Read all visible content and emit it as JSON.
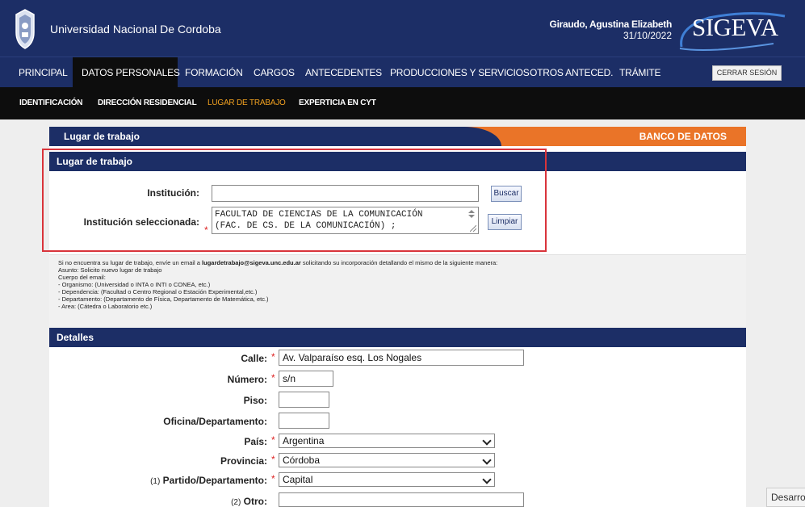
{
  "header": {
    "university": "Universidad Nacional De Cordoba",
    "user_name": "Giraudo, Agustina Elizabeth",
    "date": "31/10/2022",
    "logo": "SIGEVA"
  },
  "main_nav": [
    {
      "label": "PRINCIPAL",
      "active": false
    },
    {
      "label": "DATOS PERSONALES",
      "active": true
    },
    {
      "label": "FORMACIÓN",
      "active": false
    },
    {
      "label": "CARGOS",
      "active": false
    },
    {
      "label": "ANTECEDENTES",
      "active": false
    },
    {
      "label": "PRODUCCIONES Y SERVICIOS",
      "active": false
    },
    {
      "label": "OTROS ANTECED.",
      "active": false
    },
    {
      "label": "TRÁMITE",
      "active": false
    }
  ],
  "logout_label": "CERRAR SESIÓN",
  "sub_nav": [
    {
      "label": "IDENTIFICACIÓN",
      "active": false
    },
    {
      "label": "DIRECCIÓN RESIDENCIAL",
      "active": false
    },
    {
      "label": "LUGAR DE TRABAJO",
      "active": true
    },
    {
      "label": "EXPERTICIA EN CYT",
      "active": false
    }
  ],
  "page": {
    "title": "Lugar de trabajo",
    "banner": "BANCO DE DATOS"
  },
  "lugar": {
    "section_title": "Lugar de trabajo",
    "institucion_label": "Institución:",
    "institucion_value": "",
    "buscar": "Buscar",
    "seleccionada_label": "Institución seleccionada:",
    "seleccionada_lines": [
      "FACULTAD DE CIENCIAS DE LA COMUNICACIÓN",
      "(FAC. DE CS. DE LA COMUNICACIÓN) ;"
    ],
    "limpiar": "Limpiar"
  },
  "info": {
    "intro_1": "Si no encuentra su lugar de trabajo, envíe un email a ",
    "email": "lugardetrabajo@sigeva.unc.edu.ar",
    "intro_2": " solicitando su incorporación detallando el mismo de la siguiente manera:",
    "lines": [
      "Asunto: Solicito nuevo lugar de trabajo",
      "Cuerpo del email:",
      "- Organismo: (Universidad o INTA o INTI o CONEA, etc.)",
      "- Dependencia: (Facultad o Centro Regional o Estación Experimental,etc.)",
      "- Departamento: (Departamento de Física, Departamento de Matemática, etc.)",
      "- Area: (Cátedra o Laboratorio etc.)"
    ]
  },
  "detalles": {
    "section_title": "Detalles",
    "calle_label": "Calle:",
    "calle_value": "Av. Valparaíso esq. Los Nogales",
    "numero_label": "Número:",
    "numero_value": "s/n",
    "piso_label": "Piso:",
    "piso_value": "",
    "oficina_label": "Oficina/Departamento:",
    "oficina_value": "",
    "pais_label": "País:",
    "pais_value": "Argentina",
    "provincia_label": "Provincia:",
    "provincia_value": "Córdoba",
    "partido_prefix": "(1)",
    "partido_label": "Partido/Departamento:",
    "partido_value": "Capital",
    "otro_prefix": "(2)",
    "otro_label": "Otro:",
    "otro_value": ""
  },
  "footer_tab": "Desarrollo",
  "required_mark": "*",
  "colors": {
    "navy": "#1c2e66",
    "orange": "#ea7428",
    "highlight": "#d9343b",
    "active_sub": "#f0a020"
  }
}
